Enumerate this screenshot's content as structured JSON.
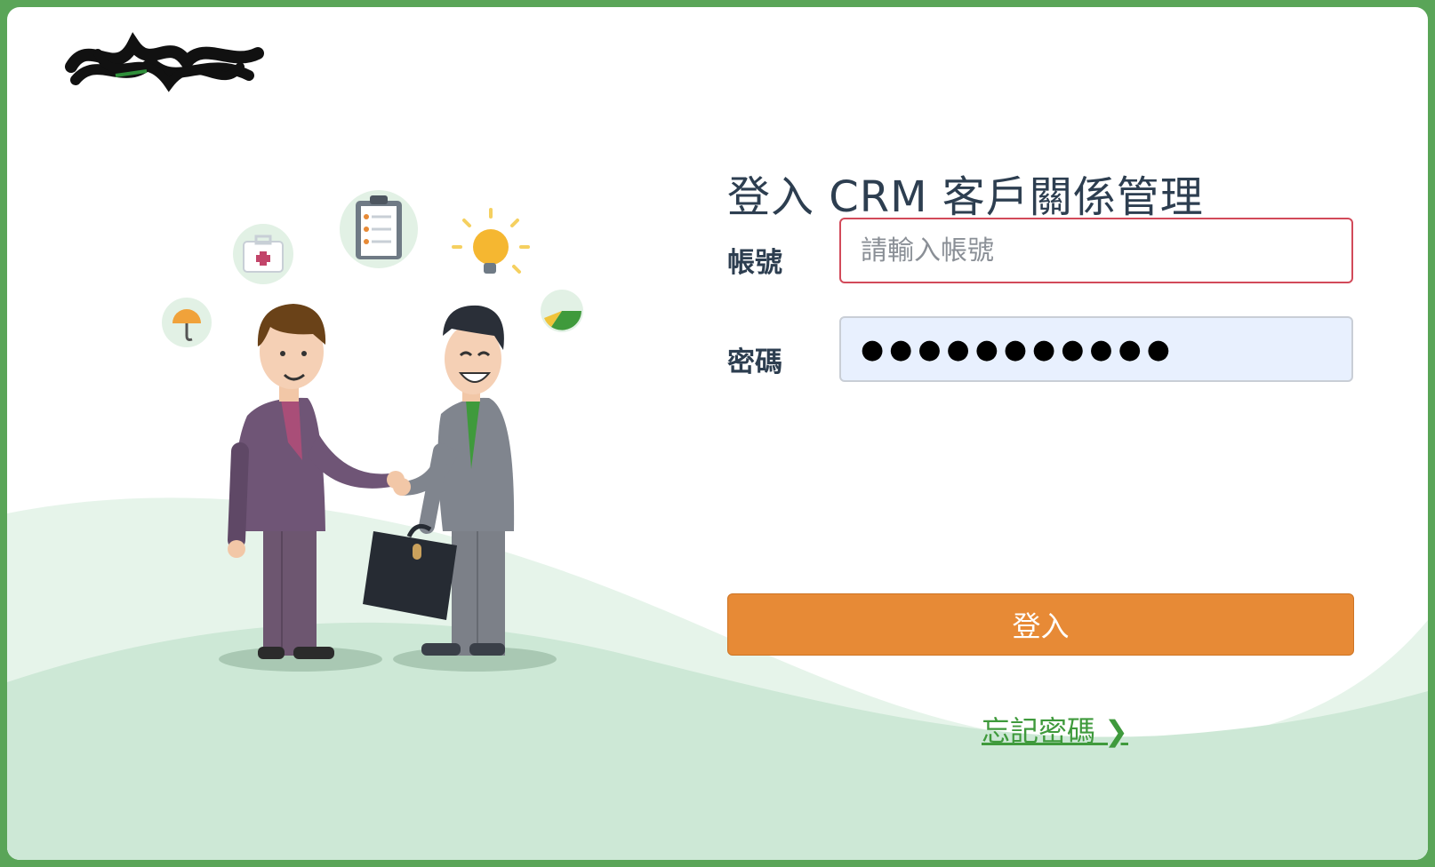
{
  "header": {
    "title": "登入 CRM 客戶關係管理"
  },
  "form": {
    "account_label": "帳號",
    "account_placeholder": "請輸入帳號",
    "account_value": "",
    "password_label": "密碼",
    "password_value": "●●●●●●●●●●●"
  },
  "actions": {
    "login_label": "登入",
    "forgot_label": "忘記密碼 ❯"
  },
  "colors": {
    "frame_green": "#5aa558",
    "primary_orange": "#e78a36",
    "link_green": "#3f9a3c",
    "title_text": "#2d3e50",
    "wave_light": "#e6f4ea",
    "wave_mid": "#cde8d6"
  },
  "icons": [
    "logo-redacted",
    "first-aid-kit-icon",
    "clipboard-icon",
    "lightbulb-icon",
    "umbrella-icon",
    "pie-chart-icon",
    "briefcase-icon"
  ]
}
